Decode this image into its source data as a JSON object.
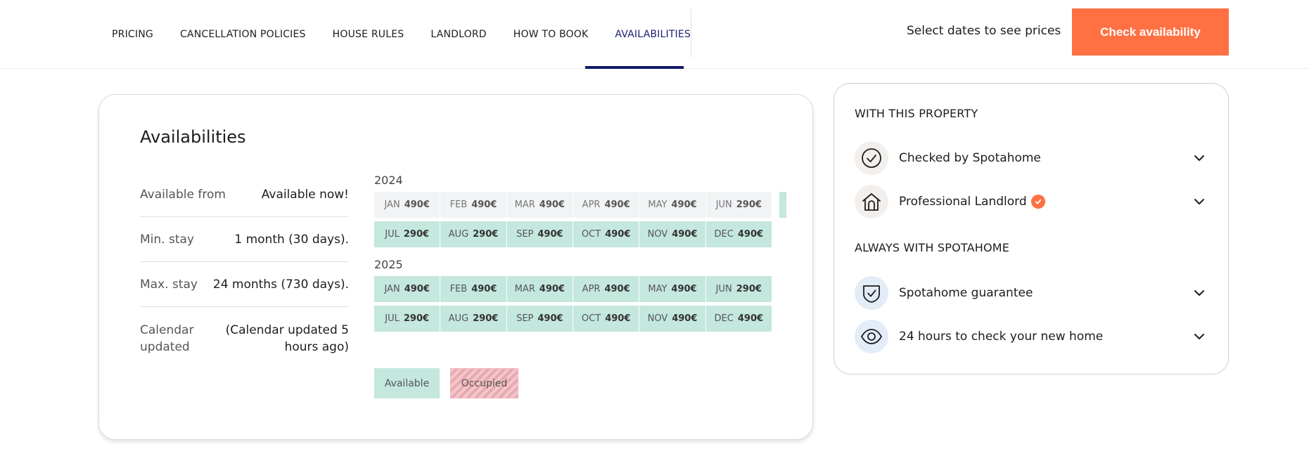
{
  "nav": {
    "items": [
      {
        "label": "PRICING"
      },
      {
        "label": "CANCELLATION POLICIES"
      },
      {
        "label": "HOUSE RULES"
      },
      {
        "label": "LANDLORD"
      },
      {
        "label": "HOW TO BOOK"
      },
      {
        "label": "AVAILABILITIES",
        "active": true
      }
    ],
    "prompt": "Select dates to see prices",
    "cta": "Check availability"
  },
  "colors": {
    "accent": "#ff7043",
    "nav_active": "#121a6b",
    "available": "#c4e7de",
    "past_month": "#f1f3f5",
    "occupied": "#f2c8cc"
  },
  "availability": {
    "title": "Availabilities",
    "info": [
      {
        "label": "Available from",
        "value": "Available now!"
      },
      {
        "label": "Min. stay",
        "value": "1 month (30 days)."
      },
      {
        "label": "Max. stay",
        "value": "24 months (730 days)."
      },
      {
        "label": "Calendar updated",
        "value": "(Calendar updated 5 hours ago)"
      }
    ],
    "years": [
      {
        "year": "2024",
        "rows": [
          [
            {
              "m": "JAN",
              "p": "490€",
              "status": "past"
            },
            {
              "m": "FEB",
              "p": "490€",
              "status": "past"
            },
            {
              "m": "MAR",
              "p": "490€",
              "status": "past"
            },
            {
              "m": "APR",
              "p": "490€",
              "status": "past"
            },
            {
              "m": "MAY",
              "p": "490€",
              "status": "past"
            },
            {
              "m": "JUN",
              "p": "290€",
              "status": "past"
            }
          ],
          [
            {
              "m": "JUL",
              "p": "290€",
              "status": "available"
            },
            {
              "m": "AUG",
              "p": "290€",
              "status": "available"
            },
            {
              "m": "SEP",
              "p": "490€",
              "status": "available"
            },
            {
              "m": "OCT",
              "p": "490€",
              "status": "available"
            },
            {
              "m": "NOV",
              "p": "490€",
              "status": "available"
            },
            {
              "m": "DEC",
              "p": "490€",
              "status": "available"
            }
          ]
        ]
      },
      {
        "year": "2025",
        "rows": [
          [
            {
              "m": "JAN",
              "p": "490€",
              "status": "available"
            },
            {
              "m": "FEB",
              "p": "490€",
              "status": "available"
            },
            {
              "m": "MAR",
              "p": "490€",
              "status": "available"
            },
            {
              "m": "APR",
              "p": "490€",
              "status": "available"
            },
            {
              "m": "MAY",
              "p": "490€",
              "status": "available"
            },
            {
              "m": "JUN",
              "p": "290€",
              "status": "available"
            }
          ],
          [
            {
              "m": "JUL",
              "p": "290€",
              "status": "available"
            },
            {
              "m": "AUG",
              "p": "290€",
              "status": "available"
            },
            {
              "m": "SEP",
              "p": "490€",
              "status": "available"
            },
            {
              "m": "OCT",
              "p": "490€",
              "status": "available"
            },
            {
              "m": "NOV",
              "p": "490€",
              "status": "available"
            },
            {
              "m": "DEC",
              "p": "490€",
              "status": "available"
            }
          ]
        ]
      }
    ],
    "legend": {
      "available": "Available",
      "occupied": "Occupied"
    }
  },
  "panel": {
    "with_title": "WITH THIS PROPERTY",
    "with_items": [
      {
        "label": "Checked by Spotahome",
        "icon": "check-circle-icon"
      },
      {
        "label": "Professional Landlord",
        "icon": "house-icon",
        "badge": "verified-badge-icon"
      }
    ],
    "always_title": "ALWAYS WITH SPOTAHOME",
    "always_items": [
      {
        "label": "Spotahome guarantee",
        "icon": "shield-check-icon"
      },
      {
        "label": "24 hours to check your new home",
        "icon": "eye-icon"
      }
    ]
  }
}
